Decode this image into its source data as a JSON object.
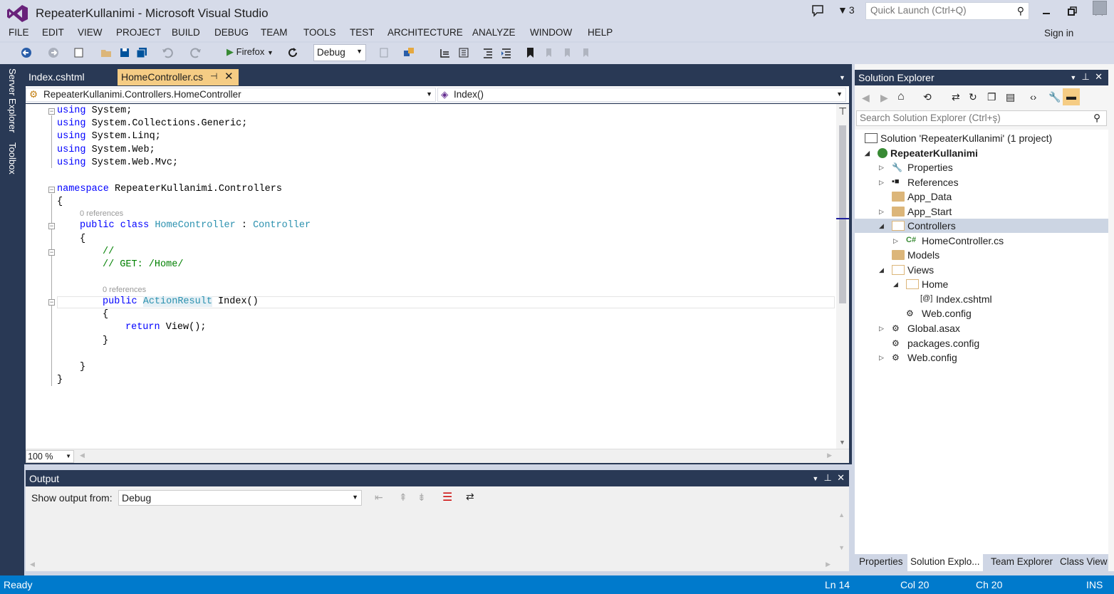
{
  "window": {
    "title": "RepeaterKullanimi - Microsoft Visual Studio",
    "notification_count": "3",
    "quick_launch_placeholder": "Quick Launch (Ctrl+Q)",
    "sign_in": "Sign in"
  },
  "menu": [
    "FILE",
    "EDIT",
    "VIEW",
    "PROJECT",
    "BUILD",
    "DEBUG",
    "TEAM",
    "TOOLS",
    "TEST",
    "ARCHITECTURE",
    "ANALYZE",
    "WINDOW",
    "HELP"
  ],
  "toolbar": {
    "run_target": "Firefox",
    "configuration": "Debug"
  },
  "left_strip": {
    "server_explorer": "Server Explorer",
    "toolbox": "Toolbox"
  },
  "tabs": [
    {
      "label": "Index.cshtml",
      "active": false
    },
    {
      "label": "HomeController.cs",
      "active": true
    }
  ],
  "navbar": {
    "type_dropdown": "RepeaterKullanimi.Controllers.HomeController",
    "member_dropdown": "Index()"
  },
  "code": {
    "line1": "using System;",
    "line2": "using System.Collections.Generic;",
    "line3": "using System.Linq;",
    "line4": "using System.Web;",
    "line5": "using System.Web.Mvc;",
    "ns_kw": "namespace",
    "ns_name": "RepeaterKullanimi.Controllers",
    "brace_open": "{",
    "brace_close": "}",
    "ref_class": "0 references",
    "class_mod": "public class",
    "class_name": "HomeController",
    "colon": ":",
    "base_class": "Controller",
    "comment1": "//",
    "comment2": "// GET: /Home/",
    "ref_method": "0 references",
    "method_mod": "public",
    "method_type": "ActionResult",
    "method_name": "Index()",
    "return_kw": "return",
    "return_expr": "View();"
  },
  "editor": {
    "zoom": "100 %"
  },
  "output": {
    "title": "Output",
    "show_from_label": "Show output from:",
    "source": "Debug"
  },
  "solution_explorer": {
    "title": "Solution Explorer",
    "search_placeholder": "Search Solution Explorer (Ctrl+ş)",
    "tree": {
      "solution": "Solution 'RepeaterKullanimi' (1 project)",
      "project": "RepeaterKullanimi",
      "properties": "Properties",
      "references": "References",
      "app_data": "App_Data",
      "app_start": "App_Start",
      "controllers": "Controllers",
      "home_controller": "HomeController.cs",
      "models": "Models",
      "views": "Views",
      "home": "Home",
      "index_cshtml": "Index.cshtml",
      "views_web_config": "Web.config",
      "global_asax": "Global.asax",
      "packages_config": "packages.config",
      "web_config": "Web.config"
    },
    "bottom_tabs": [
      "Properties",
      "Solution Explo...",
      "Team Explorer",
      "Class View"
    ]
  },
  "status": {
    "state": "Ready",
    "line": "Ln 14",
    "col": "Col 20",
    "ch": "Ch 20",
    "mode": "INS"
  },
  "colors": {
    "accent_purple": "#68217a",
    "status_blue": "#007acc",
    "tab_active": "#f5cc84",
    "panel_dark": "#293955",
    "keyword": "#0000ff",
    "type": "#2b91af",
    "comment": "#008000"
  }
}
